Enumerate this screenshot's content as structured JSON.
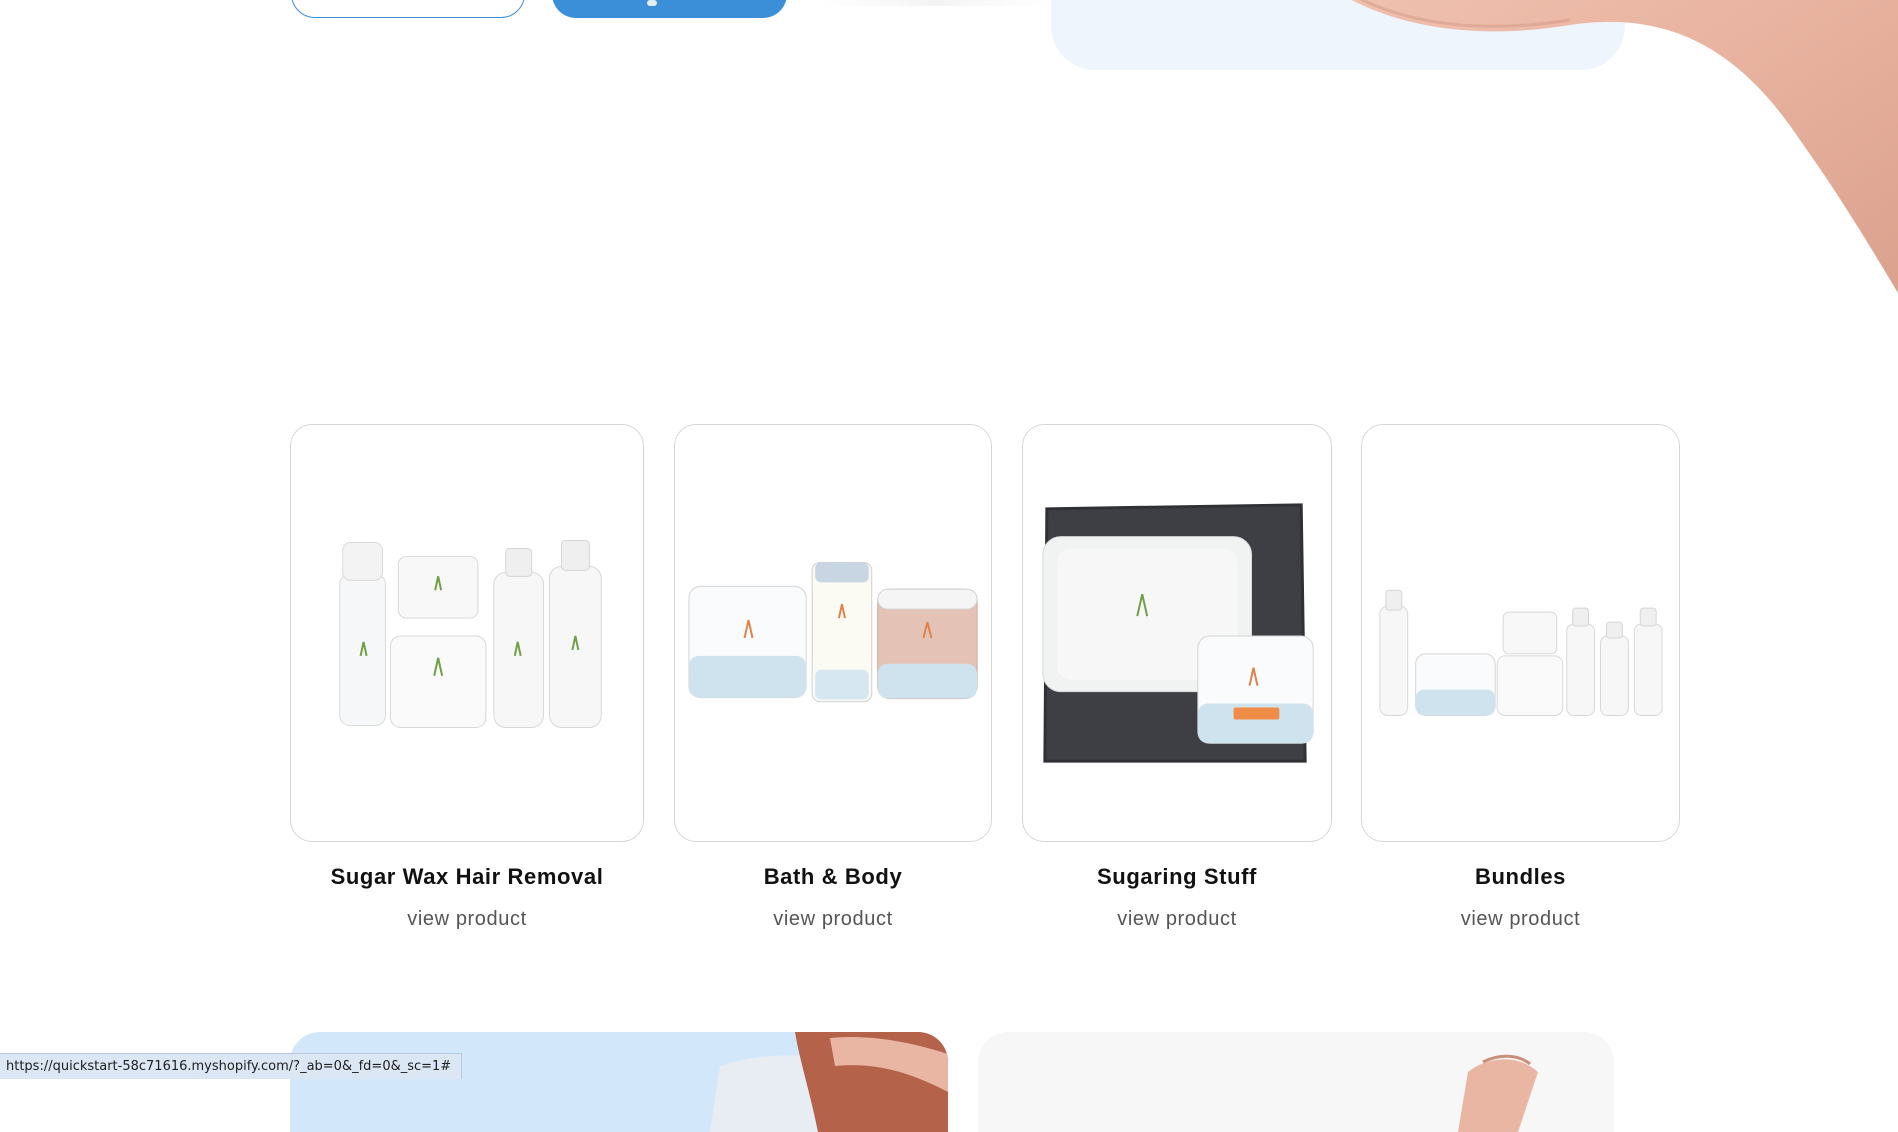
{
  "hero": {
    "button_outline_label": "",
    "button_solid_label": ""
  },
  "products": [
    {
      "title": "Sugar Wax Hair Removal",
      "link": "view product",
      "image": "sugar-wax-kit-image"
    },
    {
      "title": "Bath & Body",
      "link": "view product",
      "image": "bath-body-jars-image"
    },
    {
      "title": "Sugaring Stuff",
      "link": "view product",
      "image": "gel-pack-towel-image"
    },
    {
      "title": "Bundles",
      "link": "view product",
      "image": "bundle-set-image"
    }
  ],
  "status_bar": {
    "url": "https://quickstart-58c71616.myshopify.com/?_ab=0&_fd=0&_sc=1#"
  },
  "colors": {
    "accent": "#3b8fd9",
    "hero_panel": "#eef5fd",
    "banner_blue": "#d3e7fa",
    "banner_grey": "#f7f7f7",
    "card_border": "#d6d6d6"
  }
}
